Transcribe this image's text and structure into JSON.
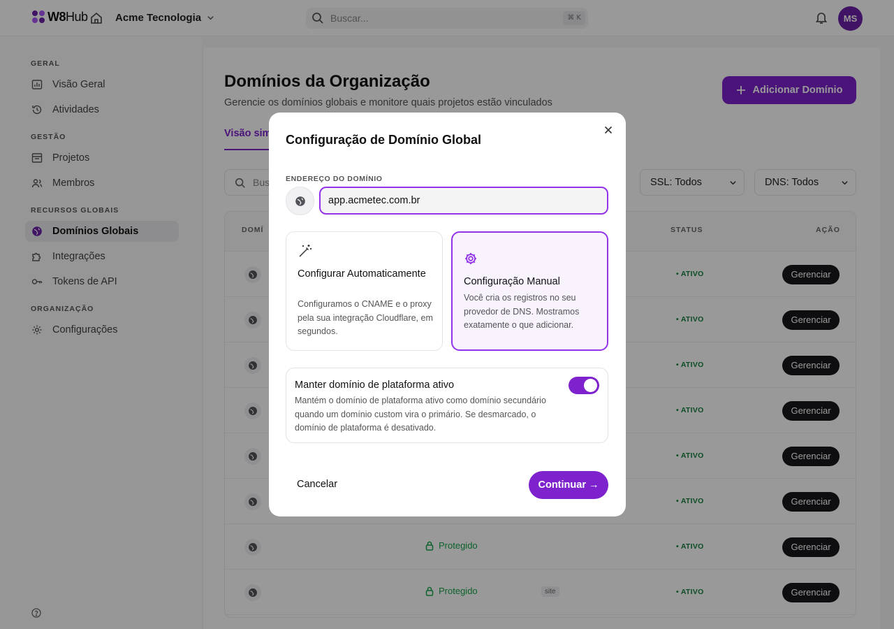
{
  "topbar": {
    "logo_bold": "W8",
    "logo_light": "Hub",
    "org_name": "Acme Tecnologia",
    "search_placeholder": "Buscar...",
    "search_shortcut": "⌘ K",
    "avatar_initials": "MS"
  },
  "sidebar": {
    "sections": [
      {
        "title": "GERAL",
        "items": [
          {
            "label": "Visão Geral",
            "icon": "grid-icon"
          },
          {
            "label": "Atividades",
            "icon": "history-icon"
          }
        ]
      },
      {
        "title": "GESTÃO",
        "items": [
          {
            "label": "Projetos",
            "icon": "folder-icon"
          },
          {
            "label": "Membros",
            "icon": "users-icon"
          }
        ]
      },
      {
        "title": "RECURSOS GLOBAIS",
        "items": [
          {
            "label": "Domínios Globais",
            "icon": "globe-icon",
            "active": true
          },
          {
            "label": "Integrações",
            "icon": "puzzle-icon"
          },
          {
            "label": "Tokens de API",
            "icon": "key-icon"
          }
        ]
      },
      {
        "title": "ORGANIZAÇÃO",
        "items": [
          {
            "label": "Configurações",
            "icon": "gear-icon"
          }
        ]
      }
    ]
  },
  "page": {
    "title": "Domínios da Organização",
    "subtitle": "Gerencie os domínios globais e monitore quais projetos estão vinculados",
    "add_button": "Adicionar Domínio",
    "tab_visible": "Visão sim",
    "filter_search_visible": "Bus",
    "ssl_filter": "SSL: Todos",
    "dns_filter": "DNS: Todos",
    "table": {
      "col_domain_visible": "DOMÍ",
      "col_status": "STATUS",
      "col_action": "AÇÃO",
      "rows": [
        {
          "ssl": "",
          "tag": "",
          "status": "ATIVO",
          "action": "Gerenciar"
        },
        {
          "ssl": "",
          "tag": "",
          "status": "ATIVO",
          "action": "Gerenciar"
        },
        {
          "ssl": "",
          "tag": "",
          "status": "ATIVO",
          "action": "Gerenciar"
        },
        {
          "ssl": "",
          "tag": "",
          "status": "ATIVO",
          "action": "Gerenciar"
        },
        {
          "ssl": "",
          "tag": "",
          "status": "ATIVO",
          "action": "Gerenciar"
        },
        {
          "ssl": "",
          "tag": "",
          "status": "ATIVO",
          "action": "Gerenciar"
        },
        {
          "ssl": "Protegido",
          "tag": "",
          "status": "ATIVO",
          "action": "Gerenciar"
        },
        {
          "ssl": "Protegido",
          "tag": "site",
          "status": "ATIVO",
          "action": "Gerenciar"
        }
      ]
    }
  },
  "modal": {
    "title": "Configuração de Domínio Global",
    "domain_label": "ENDEREÇO DO DOMÍNIO",
    "domain_value": "app.acmetec.com.br",
    "option_auto": {
      "title": "Configurar Automaticamente",
      "desc": "Configuramos o CNAME e o proxy pela sua integração Cloudflare, em segundos."
    },
    "option_manual": {
      "title": "Configuração Manual",
      "desc": "Você cria os registros no seu provedor de DNS. Mostramos exatamente o que adicionar."
    },
    "keep_platform": {
      "title": "Manter domínio de plataforma ativo",
      "desc": "Mantém o domínio de plataforma ativo como domínio secundário quando um domínio custom vira o primário. Se desmarcado, o domínio de plataforma é desativado.",
      "enabled": true
    },
    "cancel": "Cancelar",
    "continue": "Continuar →"
  },
  "colors": {
    "accent": "#7e22ce",
    "accent_border": "#9333ea",
    "success": "#16a34a"
  }
}
